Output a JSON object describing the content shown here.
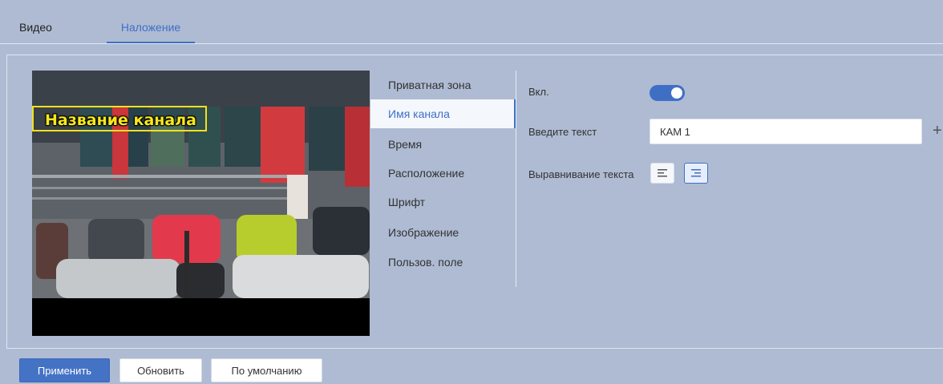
{
  "tabs": {
    "video": "Видео",
    "overlay": "Наложение"
  },
  "preview": {
    "osd_text": "Название канала"
  },
  "menu": {
    "items": [
      {
        "label": "Приватная зона"
      },
      {
        "label": "Имя канала"
      },
      {
        "label": "Время"
      },
      {
        "label": "Расположение"
      },
      {
        "label": "Шрифт"
      },
      {
        "label": "Изображение"
      },
      {
        "label": "Пользов. поле"
      }
    ],
    "active": "Имя канала"
  },
  "form": {
    "enable_label": "Вкл.",
    "enable_value": true,
    "text_label": "Введите текст",
    "text_value": "КАМ 1",
    "align_label": "Выравнивание текста",
    "align_selected": "right",
    "add_icon": "plus-icon"
  },
  "footer": {
    "apply": "Применить",
    "refresh": "Обновить",
    "default": "По умолчанию"
  },
  "colors": {
    "accent": "#3f6fc5",
    "background": "#aebbd3",
    "osd_text": "#f7e81e"
  }
}
